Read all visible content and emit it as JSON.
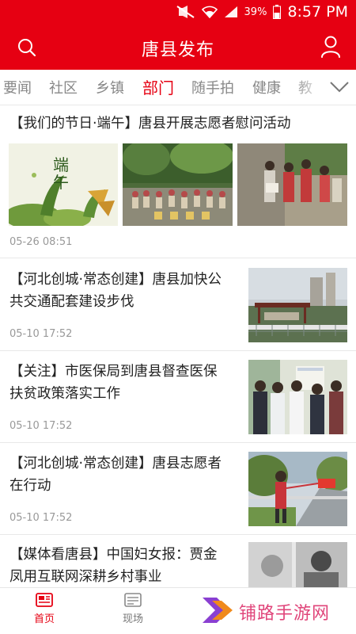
{
  "status_bar": {
    "battery": "39%",
    "time": "8:57 PM"
  },
  "header": {
    "title": "唐县发布",
    "search_icon": "search-icon",
    "user_icon": "user-icon"
  },
  "tabs": [
    "要闻",
    "社区",
    "乡镇",
    "部门",
    "随手拍",
    "健康",
    "教"
  ],
  "active_tab": "部门",
  "articles": [
    {
      "title": "【我们的节日·端午】唐县开展志愿者慰问活动",
      "time": "05-26 08:51"
    },
    {
      "title_line1": "【河北创城·常态创建】唐县加快公",
      "title_line2": "共交通配套建设步伐",
      "time": "05-10 17:52"
    },
    {
      "title_line1": "【关注】市医保局到唐县督查医保",
      "title_line2": "扶贫政策落实工作",
      "time": "05-10 17:52"
    },
    {
      "title_line1": "【河北创城·常态创建】唐县志愿者",
      "title_line2": "在行动",
      "time": "05-10 17:52"
    },
    {
      "title_line1": "【媒体看唐县】中国妇女报：贾金",
      "title_line2": "凤用互联网深耕乡村事业"
    }
  ],
  "thumb_text": {
    "duanwu": "端午"
  },
  "bottom_nav": [
    {
      "label": "首页",
      "icon": "home-news-icon"
    },
    {
      "label": "现场",
      "icon": "scene-icon"
    }
  ],
  "watermark": {
    "text": "铺路手游网"
  },
  "colors": {
    "brand_red": "#e60012",
    "text": "#222222",
    "muted": "#999999"
  }
}
